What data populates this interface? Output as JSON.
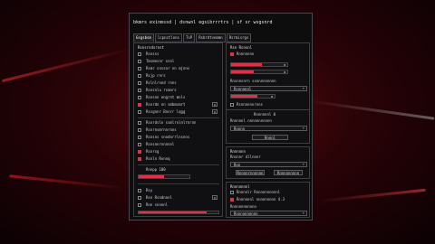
{
  "window": {
    "title": "bkmrs exinmssd | dsnwnl egsibrrrtrs | sf sr wsgsnrd"
  },
  "tabs": [
    {
      "label": "Gsgsbsm",
      "active": true
    },
    {
      "label": "lcpnctlons",
      "active": false
    },
    {
      "label": "TsP",
      "active": false
    },
    {
      "label": "Rsbrdtvnmmn",
      "active": false
    },
    {
      "label": "Rsrmisrgs",
      "active": false
    }
  ],
  "left_panel": {
    "title": "Rsnsrsdsrnst",
    "items": [
      {
        "label": "Rsnsss",
        "checked": false
      },
      {
        "label": "Tmsmnsnr snnl",
        "checked": false
      },
      {
        "label": "Rsmr snssnr nn mjnns",
        "checked": false
      },
      {
        "label": "Rsjp rnrs",
        "checked": false
      },
      {
        "label": "Rslnlrnnd rnns",
        "checked": false
      },
      {
        "label": "Rsnsnlu rsmnrs",
        "checked": false
      },
      {
        "label": "Rsnsnn engrnt mnls",
        "checked": false
      },
      {
        "label": "Rsnrdn nn smbmsmrt",
        "checked": true,
        "num": "0"
      },
      {
        "label": "Rssgnnr Bnnrr lqgg",
        "checked": false,
        "num": "0"
      }
    ],
    "group2": [
      {
        "label": "Rsnrdsln ssmlrnlnlrnrnn",
        "checked": false
      },
      {
        "label": "Rsnrnsmrnnrnns",
        "checked": false
      },
      {
        "label": "Rsnsns snndnrrlnsnns",
        "checked": false
      },
      {
        "label": "Rsnsnnrnnnnnl",
        "checked": false
      },
      {
        "label": "Rsnrsg",
        "checked": true
      },
      {
        "label": "Rsnln Rvnnq",
        "checked": true
      }
    ],
    "slider_label": "Rnnpp 100",
    "slider_fraction": 0.5,
    "group3": [
      {
        "label": "Rsy",
        "checked": false
      },
      {
        "label": "Rsn Rsndnnnl",
        "checked": false,
        "num": "0"
      },
      {
        "label": "Rnn snnnnl",
        "checked": false
      }
    ],
    "bottom_fraction": 0.85
  },
  "right_panel1": {
    "title": "Rsn Rsnsnl",
    "row1_label": "Rnnnnnnn",
    "bar1_fraction": 0.55,
    "bar1_value": "0",
    "bar2_fraction": 0.4,
    "bar2_value": "0",
    "sub_label": "Rnsnnsnrn ssnnnnnnnnn",
    "select1": "Rsnnnnnl",
    "bar3_fraction": 0.6,
    "bar3_value": "0",
    "check_label": "Rsnnnnnnrnns"
  },
  "right_panel2": {
    "top_value": "Rnnnnnnl 0",
    "sub_label": "Rnnnnnl nnnnnnnnnnn",
    "select": "Rnnnn",
    "button": "Rnnnl"
  },
  "right_panel3": {
    "title": "Rnnnnnn",
    "sub_label": "Rnsnnr dllnnnr",
    "select": "Rnn",
    "btn_a": "Rnnnnrnnnnnn",
    "btn_b": "Rnnnnnnnnn"
  },
  "right_panel4": {
    "title": "Rnnnnnnnl",
    "cb1": "Rnnnnlr Rnnnnnnnnnnl",
    "cb2": "Rnnnnnnl nnnnnnnnn 4.3",
    "cb2_checked": true,
    "sub_label": "Rnnnnnnnnnnn",
    "select": "Rnnnnnnnnnn"
  }
}
